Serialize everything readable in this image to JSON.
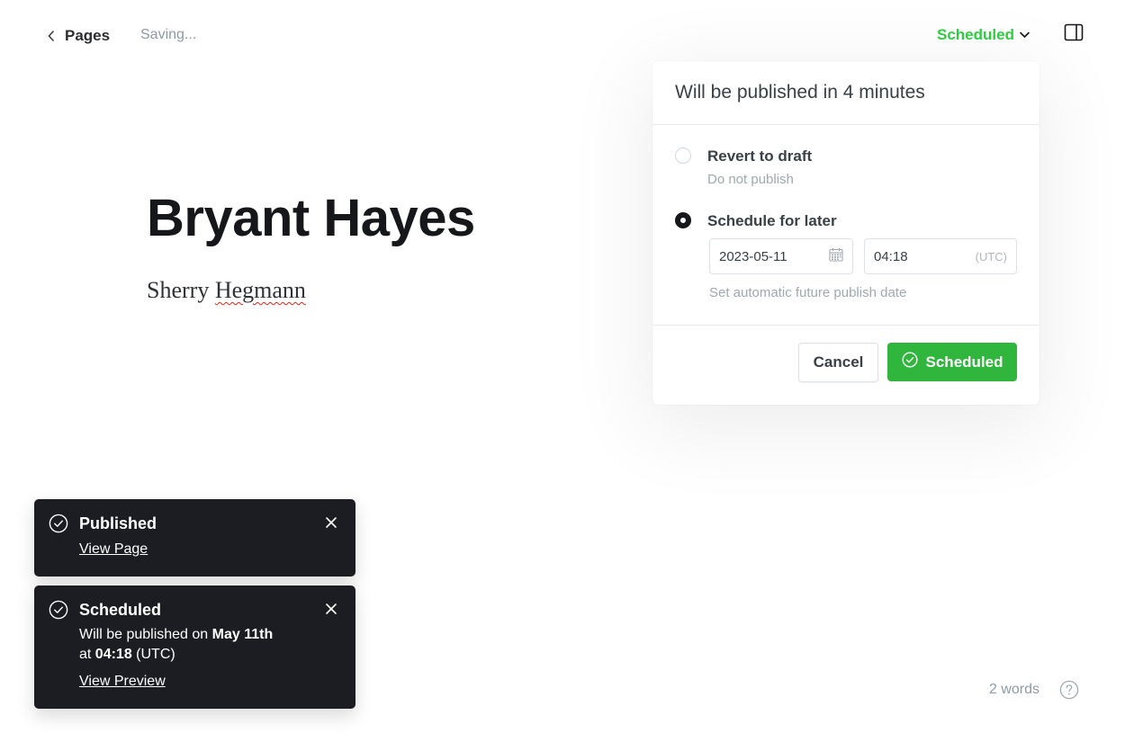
{
  "header": {
    "back_label": "Pages",
    "saving_status": "Saving...",
    "status_menu_label": "Scheduled",
    "accent_color": "#30cf43"
  },
  "post": {
    "title": "Bryant Hayes",
    "subtitle_first": "Sherry",
    "subtitle_second": "Hegmann"
  },
  "publish_popover": {
    "heading": "Will be published in 4 minutes",
    "options": [
      {
        "label": "Revert to draft",
        "description": "Do not publish",
        "selected": false
      },
      {
        "label": "Schedule for later",
        "description": "Set automatic future publish date",
        "selected": true
      }
    ],
    "date_value": "2023-05-11",
    "time_value": "04:18",
    "timezone": "(UTC)",
    "cancel_label": "Cancel",
    "confirm_label": "Scheduled",
    "confirm_color": "#30b63d"
  },
  "toasts": [
    {
      "title": "Published",
      "link": "View Page"
    },
    {
      "title": "Scheduled",
      "body_prefix": "Will be published on",
      "body_date": "May 11th",
      "body_at": "at",
      "body_time": "04:18",
      "body_tz": "(UTC)",
      "link": "View Preview"
    }
  ],
  "footer": {
    "word_count": "2 words",
    "help_icon": "question-circle-icon"
  }
}
